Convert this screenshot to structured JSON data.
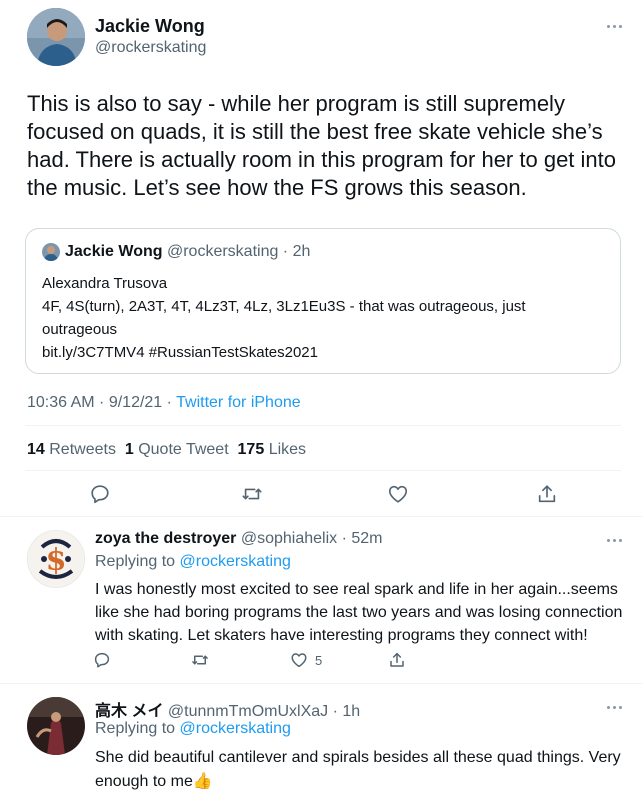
{
  "main_tweet": {
    "author_name": "Jackie Wong",
    "author_handle": "@rockerskating",
    "text_lines": [
      "This is also to say - while her program is still supremely",
      "focused on quads, it is still the best free skate vehicle she’s",
      "had. There is actually room in this program for her to get into",
      "the music. Let’s see how the FS grows this season."
    ],
    "quoted": {
      "author_name": "Jackie Wong",
      "author_handle": "@rockerskating",
      "time": "2h",
      "lines": [
        "Alexandra Trusova",
        "4F, 4S(turn), 2A3T, 4T, 4Lz3T, 4Lz, 3Lz1Eu3S - that was outrageous, just",
        "outrageous",
        "bit.ly/3C7TMV4 #RussianTestSkates2021"
      ]
    },
    "timestamp": "10:36 AM · 9/12/21 · ",
    "source": "Twitter for iPhone",
    "stats": {
      "retweets_count": "14",
      "retweets_label": "Retweets",
      "quotes_count": "1",
      "quotes_label": "Quote Tweet",
      "likes_count": "175",
      "likes_label": "Likes"
    }
  },
  "replies": [
    {
      "author_name": "zoya the destroyer",
      "author_handle": "@sophiahelix",
      "time": "52m",
      "replying_prefix": "Replying to ",
      "replying_to": "@rockerskating",
      "lines": [
        "I was honestly most excited to see real spark and life in her again...seems",
        "like she had boring programs the last two years and was losing connection",
        "with skating. Let skaters have interesting programs they connect with!"
      ],
      "like_count": "5"
    },
    {
      "author_name": "高木 メイ",
      "author_handle": "@tunnmTmOmUxlXaJ",
      "time": "1h",
      "replying_prefix": "Replying to ",
      "replying_to": "@rockerskating",
      "lines": [
        "She did beautiful cantilever and spirals besides all these quad things. Very",
        "enough to me👍"
      ]
    }
  ],
  "colors": {
    "link": "#1d9bf0",
    "secondary_text": "#536471",
    "divider": "#eff3f4"
  }
}
